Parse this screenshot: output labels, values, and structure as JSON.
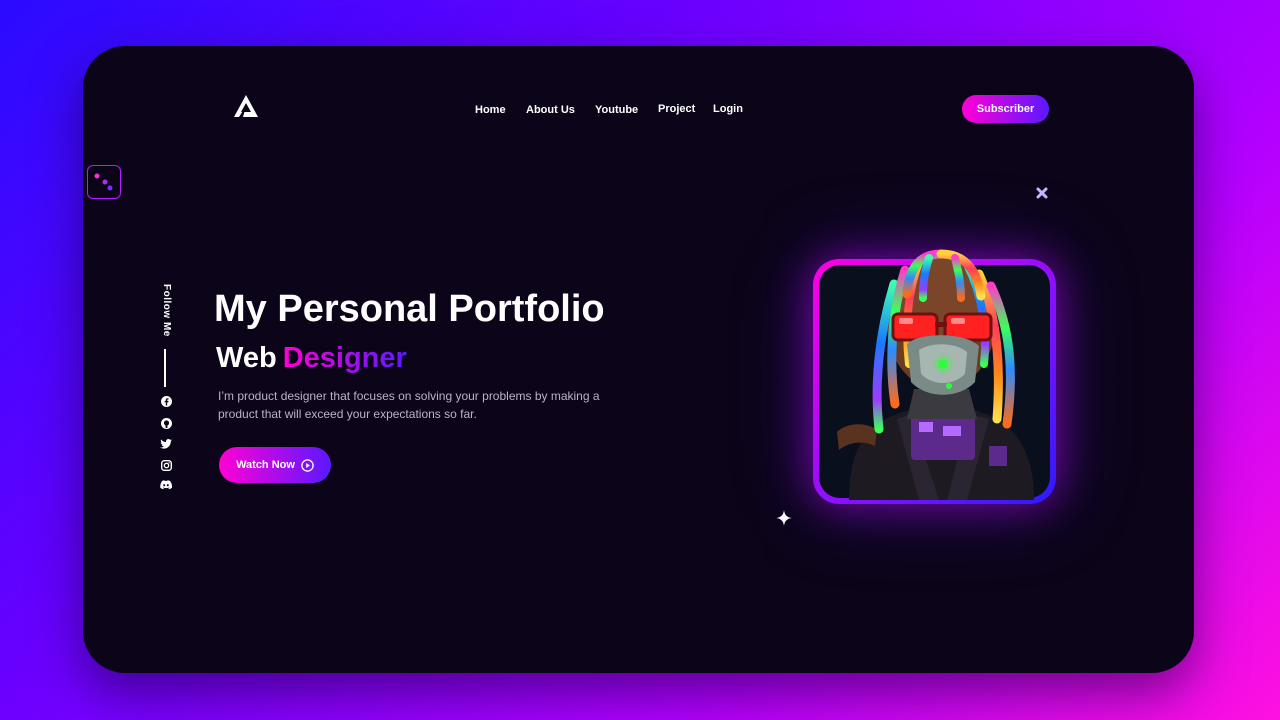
{
  "nav": {
    "items": [
      "Home",
      "About Us",
      "Youtube",
      "Project",
      "Login"
    ],
    "subscribe_label": "Subscriber"
  },
  "sidebar": {
    "follow_label": "Follow Me",
    "social_icons": [
      "facebook-icon",
      "github-icon",
      "twitter-icon",
      "instagram-icon",
      "discord-icon"
    ]
  },
  "hero": {
    "title": "My Personal Portfolio",
    "role_prefix": "Web",
    "role_highlight": "Designer",
    "description": "I’m product designer that focuses on solving your problems by making a product that will exceed your expectations so far.",
    "cta_label": "Watch Now"
  },
  "colors": {
    "accent_pink": "#ff00d4",
    "accent_blue": "#5b18ff",
    "card_bg": "#0c0519"
  }
}
